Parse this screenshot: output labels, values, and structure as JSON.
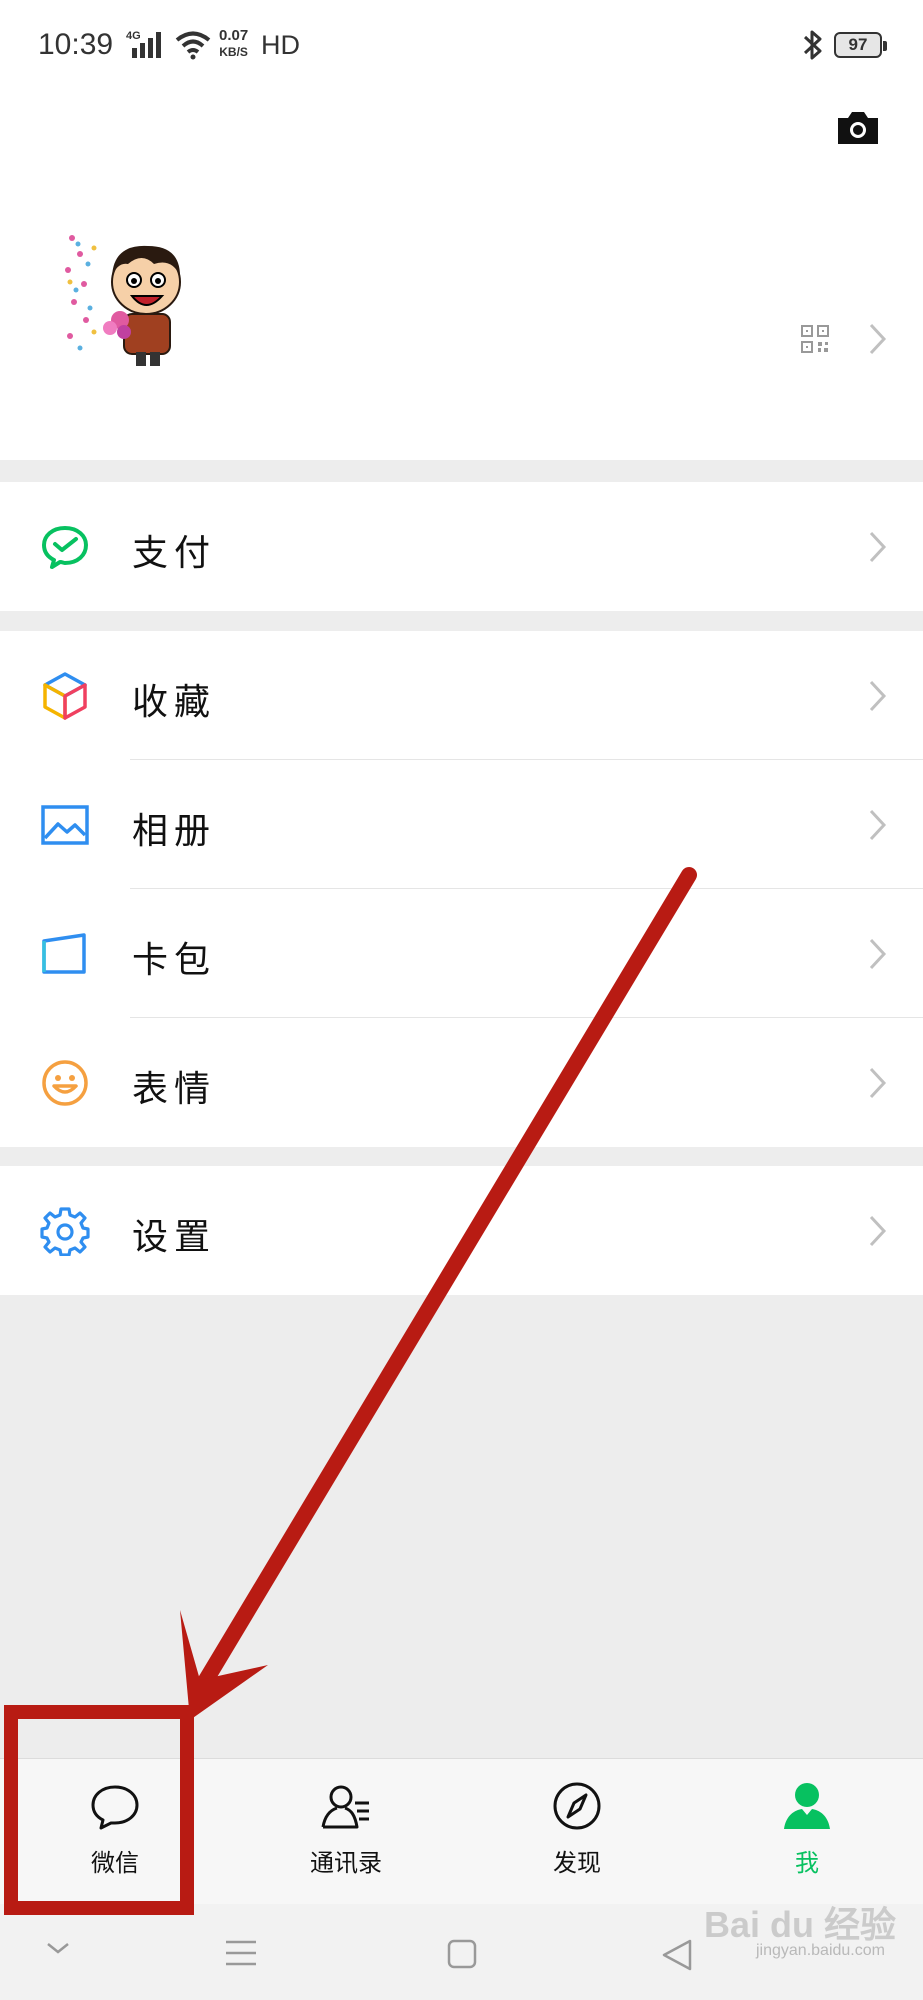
{
  "status_bar": {
    "time": "10:39",
    "network": "4G",
    "speed_value": "0.07",
    "speed_unit": "KB/S",
    "hd": "HD",
    "battery": "97"
  },
  "header": {
    "camera_icon": "camera-icon",
    "qr_icon": "qr-code-icon"
  },
  "menu": {
    "pay": "支付",
    "favorites": "收藏",
    "album": "相册",
    "cards": "卡包",
    "stickers": "表情",
    "settings": "设置"
  },
  "tabs": [
    {
      "label": "微信",
      "icon": "chat-bubble-icon",
      "active": false
    },
    {
      "label": "通讯录",
      "icon": "contacts-icon",
      "active": false
    },
    {
      "label": "发现",
      "icon": "compass-icon",
      "active": false
    },
    {
      "label": "我",
      "icon": "person-icon",
      "active": true
    }
  ],
  "colors": {
    "accent_green": "#07c160",
    "annotation_red": "#b81b13",
    "background": "#ededed"
  },
  "watermark": {
    "text": "Bai du 经验",
    "sub": "jingyan.baidu.com"
  }
}
